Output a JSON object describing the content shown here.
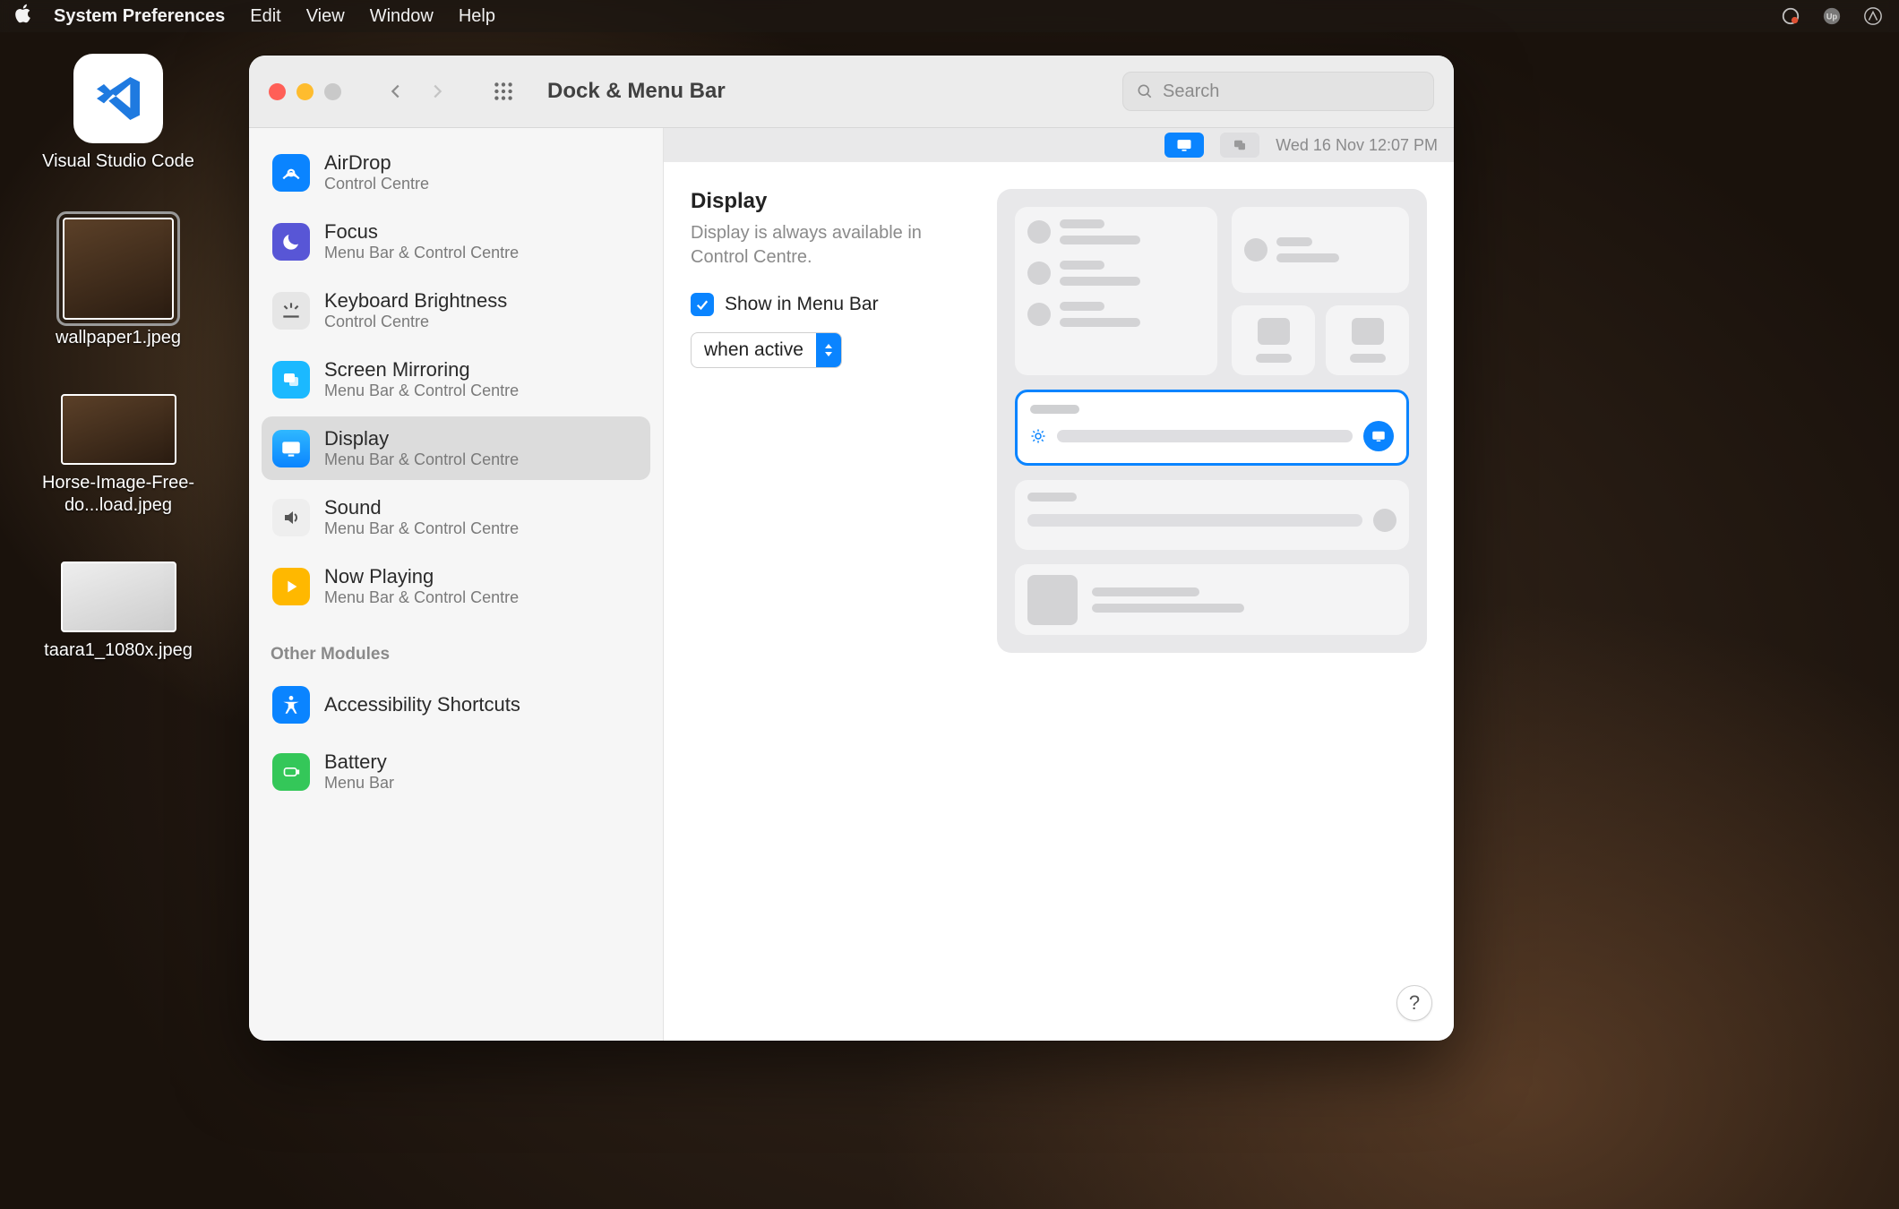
{
  "menubar": {
    "app_name": "System Preferences",
    "items": [
      "Edit",
      "View",
      "Window",
      "Help"
    ]
  },
  "desktop_icons": [
    {
      "label": "Visual Studio Code",
      "kind": "app"
    },
    {
      "label": "wallpaper1.jpeg",
      "kind": "img",
      "selected": true
    },
    {
      "label": "Horse-Image-Free-do...load.jpeg",
      "kind": "img",
      "wide": true
    },
    {
      "label": "taara1_1080x.jpeg",
      "kind": "img",
      "wide": true
    }
  ],
  "window": {
    "title": "Dock & Menu Bar",
    "search_placeholder": "Search"
  },
  "sidebar": {
    "items": [
      {
        "title": "AirDrop",
        "sub": "Control Centre",
        "icon": "airdrop",
        "color": "ic-blue"
      },
      {
        "title": "Focus",
        "sub": "Menu Bar & Control Centre",
        "icon": "moon",
        "color": "ic-purple"
      },
      {
        "title": "Keyboard Brightness",
        "sub": "Control Centre",
        "icon": "keybright",
        "color": "ic-grey"
      },
      {
        "title": "Screen Mirroring",
        "sub": "Menu Bar & Control Centre",
        "icon": "mirror",
        "color": "ic-cyan"
      },
      {
        "title": "Display",
        "sub": "Menu Bar & Control Centre",
        "icon": "display",
        "color": "ic-cyan",
        "selected": true
      },
      {
        "title": "Sound",
        "sub": "Menu Bar & Control Centre",
        "icon": "sound",
        "color": "ic-dgrey"
      },
      {
        "title": "Now Playing",
        "sub": "Menu Bar & Control Centre",
        "icon": "play",
        "color": "ic-yellow"
      }
    ],
    "other_header": "Other Modules",
    "other_items": [
      {
        "title": "Accessibility Shortcuts",
        "sub": "",
        "icon": "access",
        "color": "ic-blue"
      },
      {
        "title": "Battery",
        "sub": "Menu Bar",
        "icon": "battery",
        "color": "ic-green"
      }
    ]
  },
  "detail": {
    "menubar_clock": "Wed  16 Nov  12:07 PM",
    "heading": "Display",
    "desc": "Display is always available in Control Centre.",
    "checkbox_label": "Show in Menu Bar",
    "checkbox_checked": true,
    "select_value": "when active",
    "help": "?"
  }
}
